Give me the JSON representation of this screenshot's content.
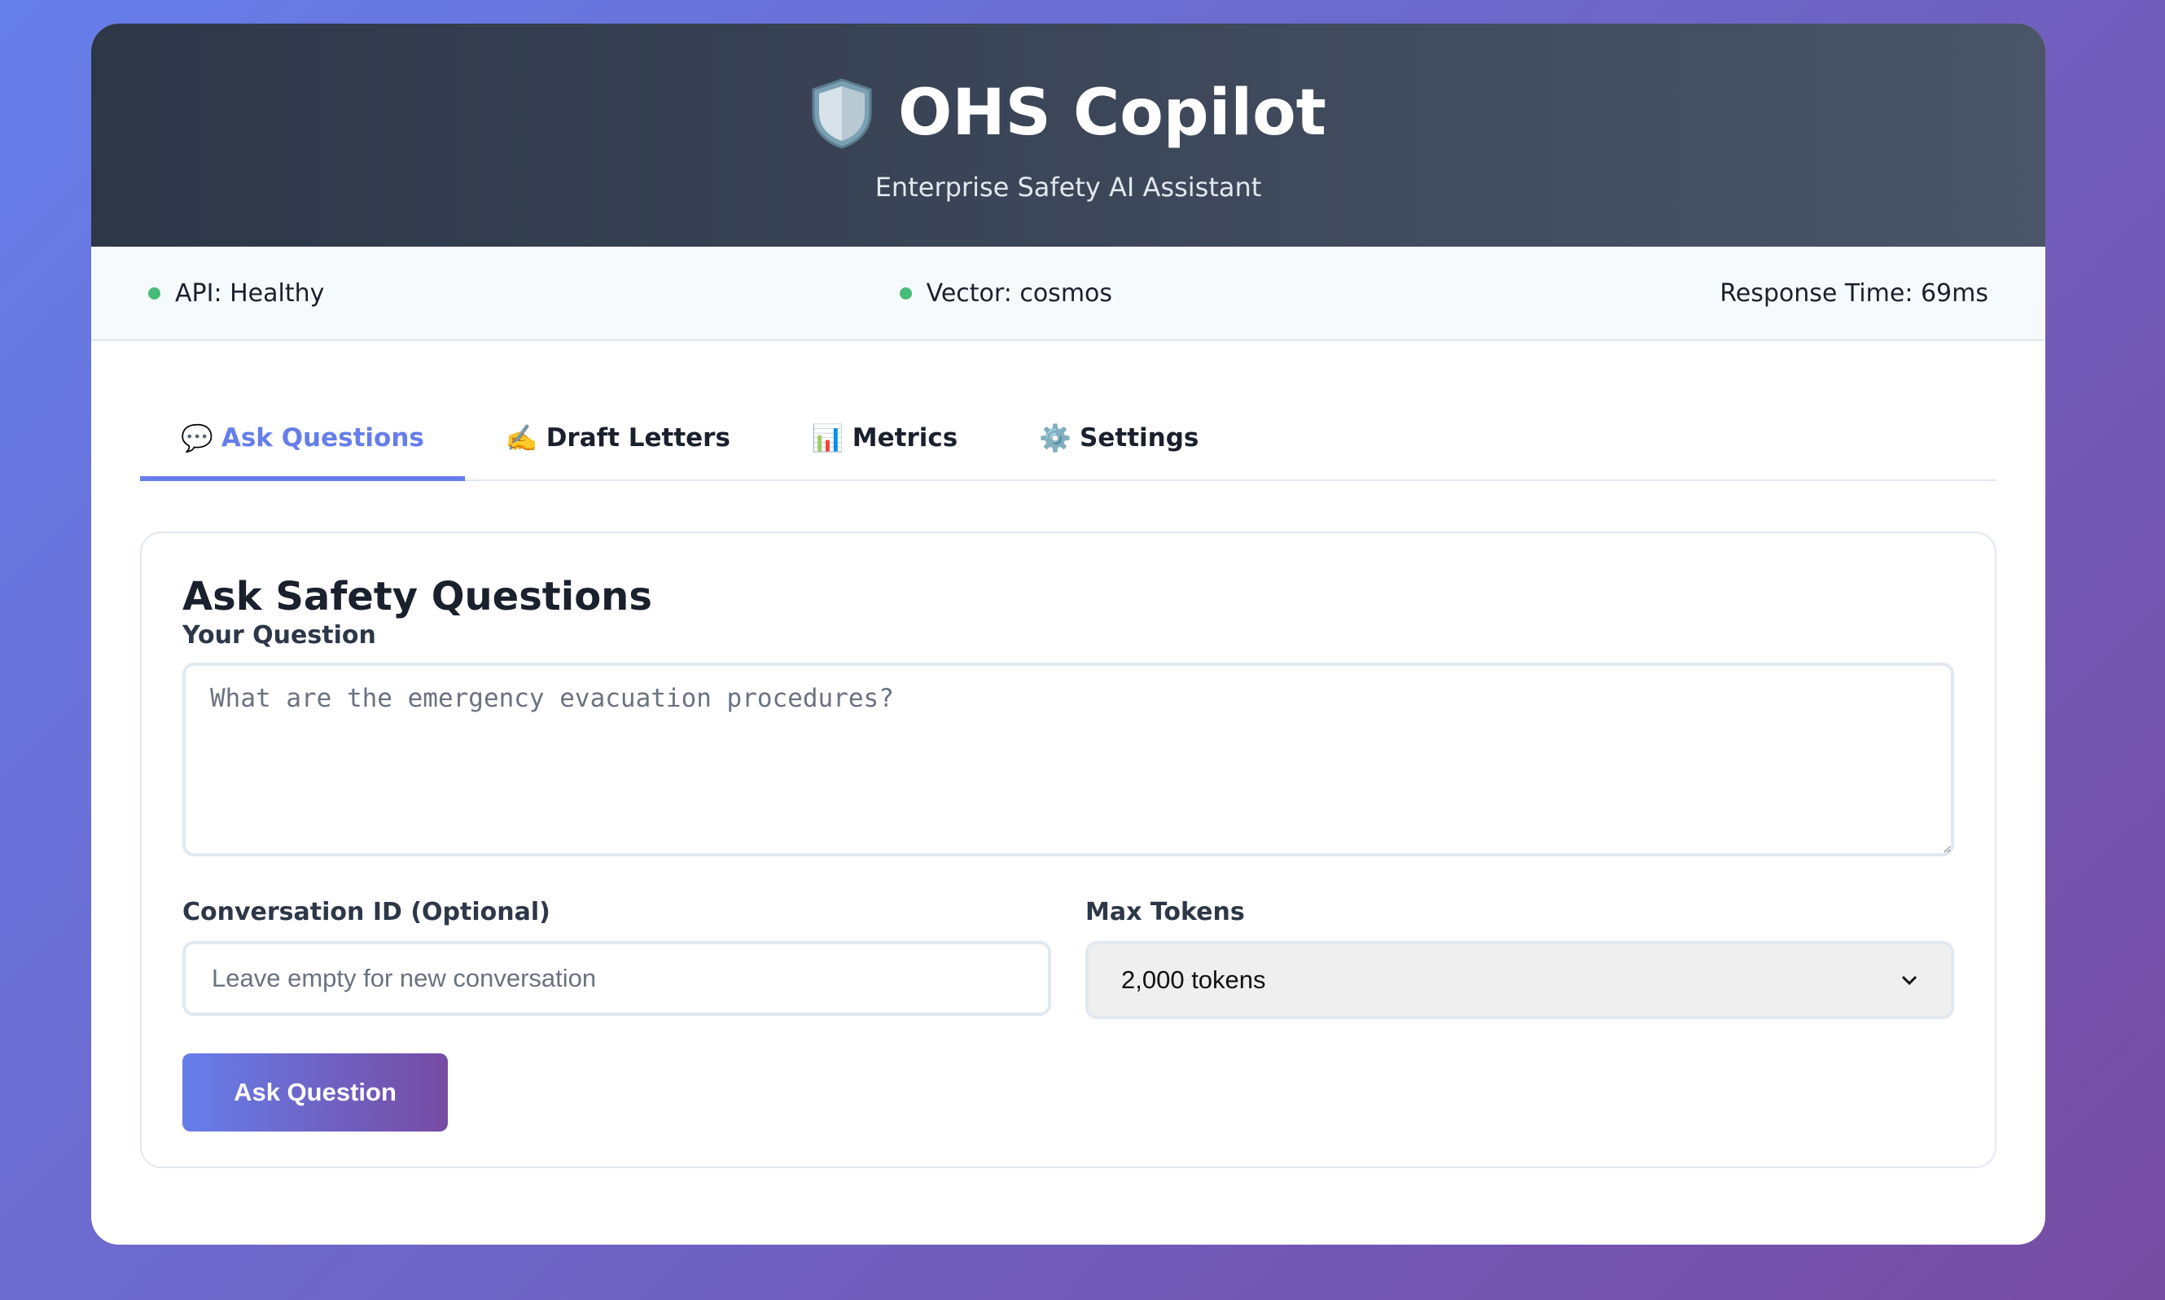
{
  "header": {
    "title": "OHS Copilot",
    "subtitle": "Enterprise Safety AI Assistant",
    "logo_icon": "shield-icon"
  },
  "status": {
    "api": "API: Healthy",
    "vector": "Vector: cosmos",
    "response_time": "Response Time: 69ms",
    "ok_color": "#48bb78"
  },
  "tabs": [
    {
      "emoji": "💬",
      "label": "Ask Questions",
      "icon": "speech-bubble-icon",
      "active": true
    },
    {
      "emoji": "✍️",
      "label": "Draft Letters",
      "icon": "writing-hand-icon",
      "active": false
    },
    {
      "emoji": "📊",
      "label": "Metrics",
      "icon": "bar-chart-icon",
      "active": false
    },
    {
      "emoji": "⚙️",
      "label": "Settings",
      "icon": "gear-icon",
      "active": false
    }
  ],
  "form": {
    "title": "Ask Safety Questions",
    "question_label": "Your Question",
    "question_value": "",
    "question_placeholder": "What are the emergency evacuation procedures?",
    "conversation_label": "Conversation ID (Optional)",
    "conversation_value": "",
    "conversation_placeholder": "Leave empty for new conversation",
    "max_tokens_label": "Max Tokens",
    "max_tokens_selected": "2,000 tokens",
    "submit_label": "Ask Question"
  },
  "colors": {
    "accent": "#667eea",
    "accent_end": "#764ba2",
    "header_dark": "#2d3748"
  }
}
